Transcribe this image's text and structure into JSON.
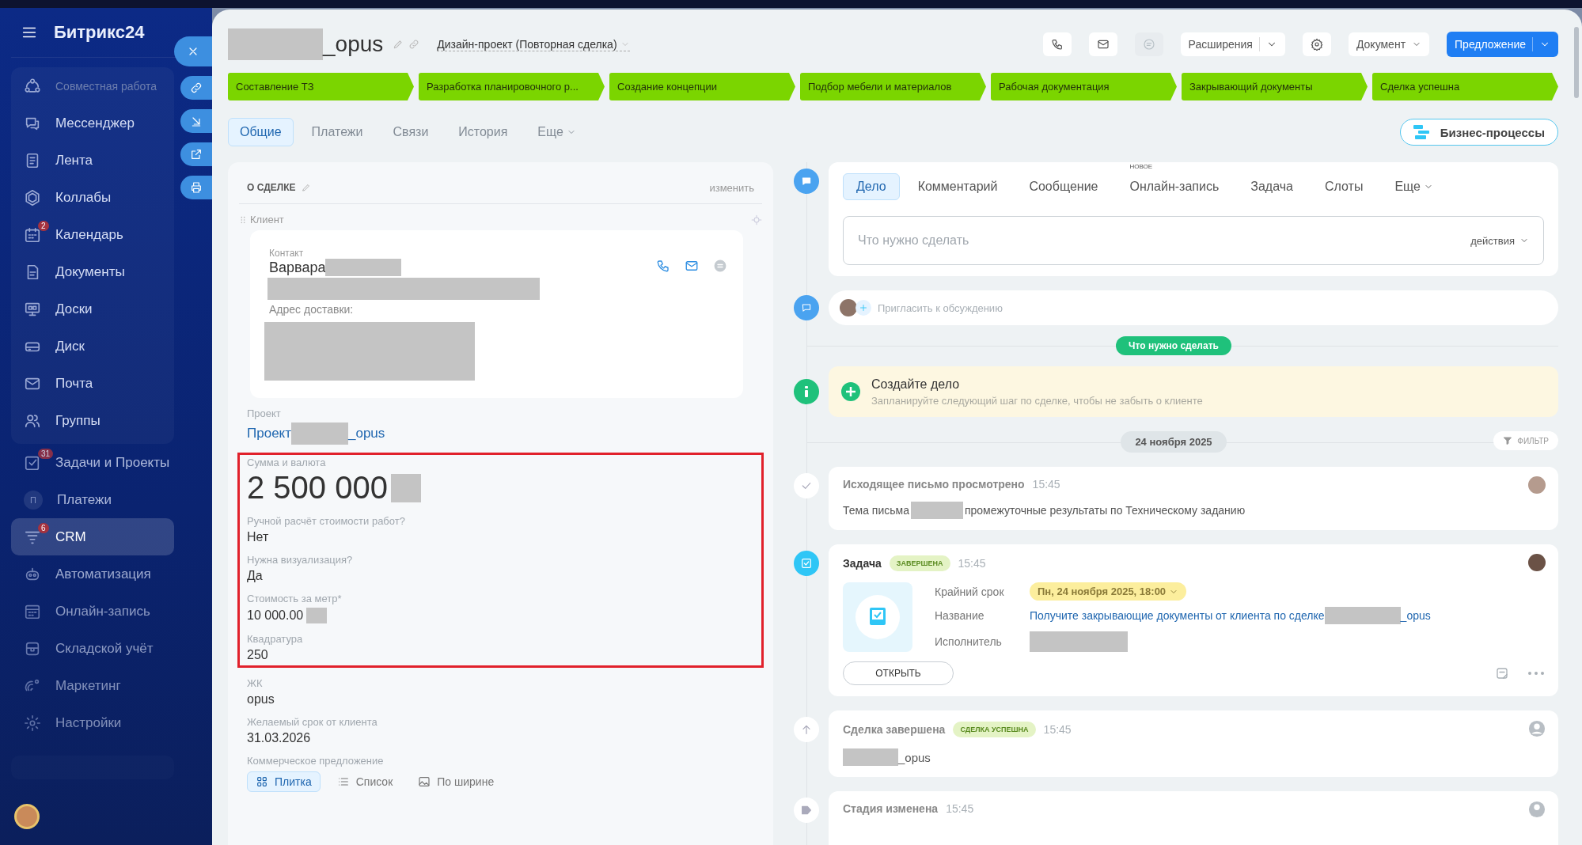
{
  "sidebar": {
    "logo": "Битрикс24",
    "items": [
      {
        "label": "Совместная работа",
        "kind": "group",
        "selected": false
      },
      {
        "label": "Мессенджер",
        "kind": "item",
        "selected": false
      },
      {
        "label": "Лента",
        "kind": "item",
        "selected": false
      },
      {
        "label": "Коллабы",
        "kind": "item",
        "selected": false
      },
      {
        "label": "Календарь",
        "kind": "item",
        "selected": false,
        "badge": "2"
      },
      {
        "label": "Документы",
        "kind": "item",
        "selected": false
      },
      {
        "label": "Доски",
        "kind": "item",
        "selected": false
      },
      {
        "label": "Диск",
        "kind": "item",
        "selected": false
      },
      {
        "label": "Почта",
        "kind": "item",
        "selected": false
      },
      {
        "label": "Группы",
        "kind": "item",
        "selected": false
      },
      {
        "label": "Задачи и Проекты",
        "kind": "item",
        "selected": false,
        "badge": "31"
      },
      {
        "label": "Платежи",
        "kind": "item",
        "selected": false,
        "icon_text": "П"
      },
      {
        "label": "CRM",
        "kind": "item",
        "selected": true,
        "badge": "6"
      },
      {
        "label": "Автоматизация",
        "kind": "item",
        "selected": false
      },
      {
        "label": "Онлайн-запись",
        "kind": "item",
        "selected": false
      },
      {
        "label": "Складской учёт",
        "kind": "item",
        "selected": false
      },
      {
        "label": "Маркетинг",
        "kind": "item",
        "selected": false
      },
      {
        "label": "Настройки",
        "kind": "item",
        "selected": false
      }
    ]
  },
  "deal": {
    "title_suffix": "_opus",
    "category": "Дизайн-проект (Повторная сделка)"
  },
  "toolbar": {
    "extensions": "Расширения",
    "document": "Документ",
    "offer": "Предложение"
  },
  "stages": [
    {
      "label": "Составление ТЗ",
      "passed": true
    },
    {
      "label": "Разработка планировочного р...",
      "passed": true
    },
    {
      "label": "Создание концепции",
      "passed": true
    },
    {
      "label": "Подбор мебели и материалов",
      "passed": true
    },
    {
      "label": "Рабочая документация",
      "passed": true
    },
    {
      "label": "Закрывающий документы",
      "passed": true
    },
    {
      "label": "Сделка успешна",
      "passed": true
    }
  ],
  "tabs": [
    {
      "label": "Общие",
      "selected": true,
      "dropdown": false
    },
    {
      "label": "Платежи",
      "selected": false,
      "dropdown": false
    },
    {
      "label": "Связи",
      "selected": false,
      "dropdown": false
    },
    {
      "label": "История",
      "selected": false,
      "dropdown": false
    },
    {
      "label": "Еще",
      "selected": false,
      "dropdown": true
    }
  ],
  "bp_button": "Бизнес-процессы",
  "about": {
    "title": "О СДЕЛКЕ",
    "edit": "изменить",
    "client_label": "Клиент",
    "contact": {
      "label": "Контакт",
      "name": "Варвара",
      "address_label": "Адрес доставки:"
    },
    "fields": [
      {
        "label": "Проект",
        "value": "Проект",
        "suffix": "_opus",
        "redacted": true,
        "kind": "link",
        "highlighted": false
      },
      {
        "label": "Сумма и валюта",
        "value": "2 500 000",
        "redacted": true,
        "kind": "money",
        "highlighted": true
      },
      {
        "label": "Ручной расчёт стоимости работ?",
        "value": "Нет",
        "redacted": false,
        "kind": "text",
        "highlighted": true
      },
      {
        "label": "Нужна визуализация?",
        "value": "Да",
        "redacted": false,
        "kind": "text",
        "highlighted": true
      },
      {
        "label": "Стоимость за метр*",
        "value": "10 000.00",
        "redacted": true,
        "kind": "text",
        "highlighted": true
      },
      {
        "label": "Квадратура",
        "value": "250",
        "redacted": false,
        "kind": "text",
        "highlighted": true
      },
      {
        "label": "ЖК",
        "value": "opus",
        "redacted": false,
        "kind": "text",
        "highlighted": false
      },
      {
        "label": "Желаемый срок от клиента",
        "value": "31.03.2026",
        "redacted": false,
        "kind": "text",
        "highlighted": false
      }
    ],
    "proposal": {
      "label": "Коммерческое предложение",
      "views": [
        {
          "label": "Плитка",
          "selected": true
        },
        {
          "label": "Список",
          "selected": false
        },
        {
          "label": "По ширине",
          "selected": false
        }
      ]
    }
  },
  "composer": {
    "tabs": [
      {
        "label": "Дело",
        "selected": true
      },
      {
        "label": "Комментарий",
        "selected": false
      },
      {
        "label": "Сообщение",
        "selected": false
      },
      {
        "label": "Онлайн-запись",
        "selected": false,
        "badge": "НОВОЕ"
      },
      {
        "label": "Задача",
        "selected": false
      },
      {
        "label": "Слоты",
        "selected": false
      },
      {
        "label": "Еще",
        "selected": false,
        "dropdown": true
      }
    ],
    "placeholder": "Что нужно сделать",
    "actions": "действия"
  },
  "invite": "Пригласить к обсуждению",
  "todo_divider": "Что нужно сделать",
  "create": {
    "title": "Создайте дело",
    "hint": "Запланируйте следующий шаг по сделке, чтобы не забыть о клиенте"
  },
  "date": "24 ноября 2025",
  "filter": "ФИЛЬТР",
  "events": [
    {
      "kind": "email",
      "title": "Исходящее письмо просмотрено",
      "time": "15:45",
      "text_before": "Тема письма",
      "text_after": "промежуточные результаты по Техническому заданию"
    },
    {
      "kind": "task",
      "title": "Задача",
      "status": "ЗАВЕРШЕНА",
      "time": "15:45",
      "deadline_label": "Крайний срок",
      "deadline": "Пн, 24 ноября 2025, 18:00",
      "name_label": "Название",
      "name": "Получите закрывающие документы от клиента по сделке",
      "name_suffix": "_opus",
      "assignee_label": "Исполнитель",
      "open": "ОТКРЫТЬ"
    },
    {
      "kind": "stage",
      "title": "Сделка завершена",
      "status": "СДЕЛКА УСПЕШНА",
      "time": "15:45",
      "suffix": "_opus"
    },
    {
      "kind": "partial",
      "title": "Стадия изменена",
      "time": "15:45"
    }
  ]
}
